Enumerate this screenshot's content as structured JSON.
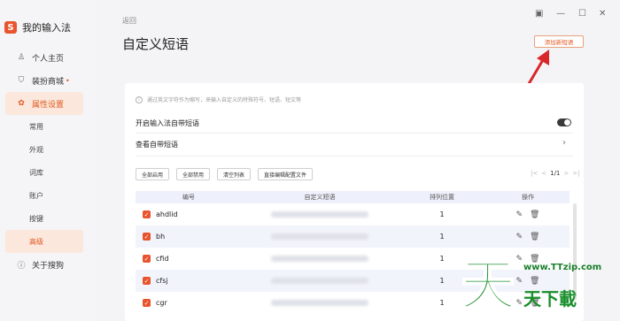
{
  "app": {
    "name": "我的输入法",
    "logo_letter": "S"
  },
  "sidebar": {
    "items": [
      {
        "label": "个人主页",
        "icon": "person-icon"
      },
      {
        "label": "装扮商城",
        "icon": "shirt-icon",
        "badge_dot": "•"
      },
      {
        "label": "属性设置",
        "icon": "gear-icon"
      }
    ],
    "subitems": [
      "常用",
      "外观",
      "词库",
      "账户",
      "按键",
      "高级"
    ],
    "about": {
      "label": "关于搜狗",
      "icon": "info-icon"
    }
  },
  "header": {
    "back": "返回",
    "title": "自定义短语",
    "add_button": "添加新短语"
  },
  "card": {
    "hint": "通过英文字符作为缩写，来输入自定义的特殊符号、短语、短文等",
    "toggle_label": "开启输入法自带短语",
    "toggle_on": true,
    "view_label": "查看自带短语"
  },
  "toolbar": {
    "buttons": [
      "全部启用",
      "全部禁用",
      "清空列表",
      "直接编辑配置文件"
    ],
    "pager": {
      "prev_first": "|<",
      "prev": "<",
      "current": "1/1",
      "next": ">",
      "next_last": ">|"
    }
  },
  "table": {
    "columns": [
      "编号",
      "自定义短语",
      "排列位置",
      "操作"
    ],
    "rows": [
      {
        "code": "ahdlid",
        "position": "1"
      },
      {
        "code": "bh",
        "position": "1"
      },
      {
        "code": "cfid",
        "position": "1"
      },
      {
        "code": "cfsj",
        "position": "1"
      },
      {
        "code": "cgr",
        "position": "1"
      }
    ]
  },
  "watermark": {
    "glyph": "天",
    "url": "www.TTzip.com",
    "name": "天下載"
  },
  "colors": {
    "accent": "#e8542d",
    "accent_bg": "#fbe7dc",
    "table_header": "#eef0fb",
    "watermark": "#1a8f2c"
  }
}
